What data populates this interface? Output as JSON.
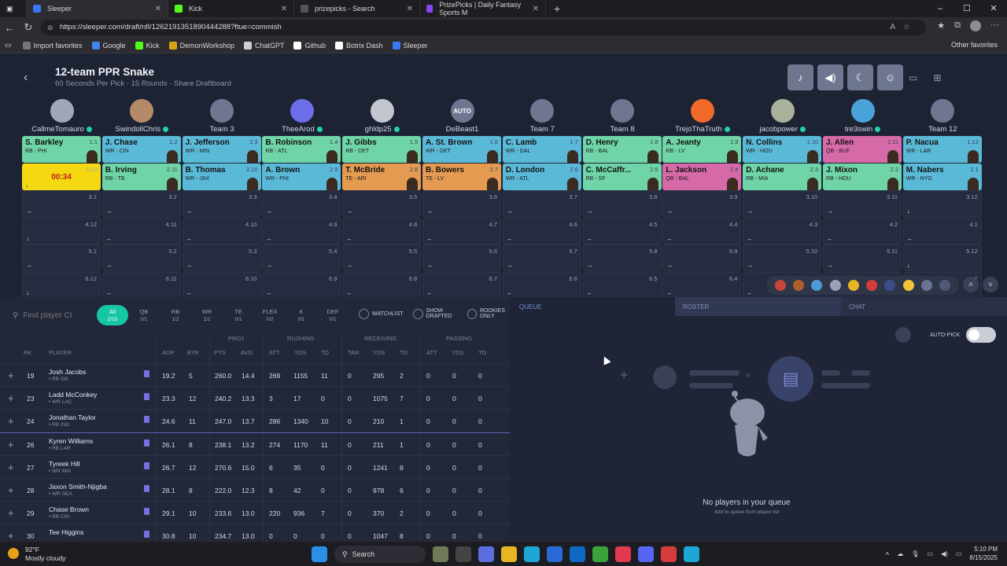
{
  "browser": {
    "tabs": [
      {
        "label": "Sleeper",
        "color": "#3a78f2",
        "active": true
      },
      {
        "label": "Kick",
        "color": "#53fc18",
        "active": false
      },
      {
        "label": "prizepicks - Search",
        "color": "#555",
        "active": false
      },
      {
        "label": "PrizePicks | Daily Fantasy Sports M",
        "color": "#8b43f2",
        "active": false
      }
    ],
    "url": "https://sleeper.com/draft/nfl/1262191351890444288?ftue=commish",
    "bookmarks": [
      {
        "label": "Import favorites",
        "color": "#777"
      },
      {
        "label": "Google",
        "color": "#4285f4"
      },
      {
        "label": "Kick",
        "color": "#53fc18"
      },
      {
        "label": "DemonWorkshop",
        "color": "#d9a318"
      },
      {
        "label": "ChatGPT",
        "color": "#cfcfcf"
      },
      {
        "label": "Github",
        "color": "#ffffff"
      },
      {
        "label": "Botrix Dash",
        "color": "#ffffff"
      },
      {
        "label": "Sleeper",
        "color": "#3a78f2"
      }
    ],
    "other_favorites": "Other favorites"
  },
  "draft": {
    "title": "12-team PPR Snake",
    "subtitle": "60 Seconds Per Pick · 15 Rounds · Share Draftboard"
  },
  "teams": [
    {
      "name": "CallmeTomauro",
      "online": true,
      "color": "#9fa7b9"
    },
    {
      "name": "SwindollChris",
      "online": true,
      "color": "#b48a6a"
    },
    {
      "name": "Team 3",
      "online": false,
      "color": "#6e7690"
    },
    {
      "name": "TheeArod",
      "online": true,
      "color": "#6b6ee8"
    },
    {
      "name": "ghldp25",
      "online": true,
      "color": "#c2c6cf"
    },
    {
      "name": "DeBeast1",
      "online": false,
      "color": "#6e7690",
      "badge": "AUTO"
    },
    {
      "name": "Team 7",
      "online": false,
      "color": "#6e7690"
    },
    {
      "name": "Team 8",
      "online": false,
      "color": "#6e7690"
    },
    {
      "name": "TrejoThaTruth",
      "online": true,
      "color": "#f06a2a"
    },
    {
      "name": "jacobpower",
      "online": true,
      "color": "#a9b29a"
    },
    {
      "name": "tre3swin",
      "online": true,
      "color": "#4aa3d8"
    },
    {
      "name": "Team 12",
      "online": false,
      "color": "#6e7690"
    }
  ],
  "round1": [
    {
      "name": "S. Barkley",
      "pos": "RB - PHI",
      "pick": "1.1",
      "color": "#6fd4a8"
    },
    {
      "name": "J. Chase",
      "pos": "WR - CIN",
      "pick": "1.2",
      "color": "#5bb9d8"
    },
    {
      "name": "J. Jefferson",
      "pos": "WR - MIN",
      "pick": "1.3",
      "color": "#5bb9d8"
    },
    {
      "name": "B. Robinson",
      "pos": "RB - ATL",
      "pick": "1.4",
      "color": "#6fd4a8"
    },
    {
      "name": "J. Gibbs",
      "pos": "RB - DET",
      "pick": "1.5",
      "color": "#6fd4a8"
    },
    {
      "name": "A. St. Brown",
      "pos": "WR - DET",
      "pick": "1.6",
      "color": "#5bb9d8"
    },
    {
      "name": "C. Lamb",
      "pos": "WR - DAL",
      "pick": "1.7",
      "color": "#5bb9d8"
    },
    {
      "name": "D. Henry",
      "pos": "RB - BAL",
      "pick": "1.8",
      "color": "#6fd4a8"
    },
    {
      "name": "A. Jeanty",
      "pos": "RB - LV",
      "pick": "1.9",
      "color": "#6fd4a8"
    },
    {
      "name": "N. Collins",
      "pos": "WR - HOU",
      "pick": "1.10",
      "color": "#5bb9d8"
    },
    {
      "name": "J. Allen",
      "pos": "QB - BUF",
      "pick": "1.11",
      "color": "#d66aa8"
    },
    {
      "name": "P. Nacua",
      "pos": "WR - LAR",
      "pick": "1.12",
      "color": "#5bb9d8"
    }
  ],
  "round2": [
    {
      "timer": "00:34",
      "pick": "2.12"
    },
    {
      "name": "B. Irving",
      "pos": "RB - TB",
      "pick": "2.11",
      "color": "#6fd4a8"
    },
    {
      "name": "B. Thomas",
      "pos": "WR - JAX",
      "pick": "2.10",
      "color": "#5bb9d8"
    },
    {
      "name": "A. Brown",
      "pos": "WR - PHI",
      "pick": "2.9",
      "color": "#5bb9d8"
    },
    {
      "name": "T. McBride",
      "pos": "TE - ARI",
      "pick": "2.8",
      "color": "#e59a52"
    },
    {
      "name": "B. Bowers",
      "pos": "TE - LV",
      "pick": "2.7",
      "color": "#e59a52"
    },
    {
      "name": "D. London",
      "pos": "WR - ATL",
      "pick": "2.6",
      "color": "#5bb9d8"
    },
    {
      "name": "C. McCaffr...",
      "pos": "RB - SF",
      "pick": "2.5",
      "color": "#6fd4a8"
    },
    {
      "name": "L. Jackson",
      "pos": "QB - BAL",
      "pick": "2.4",
      "color": "#d66aa8"
    },
    {
      "name": "D. Achane",
      "pos": "RB - MIA",
      "pick": "2.3",
      "color": "#6fd4a8"
    },
    {
      "name": "J. Mixon",
      "pos": "RB - HOU",
      "pick": "2.2",
      "color": "#6fd4a8"
    },
    {
      "name": "M. Nabers",
      "pos": "WR - NYG",
      "pick": "2.1",
      "color": "#5bb9d8"
    }
  ],
  "empty_rounds": [
    [
      "3.1",
      "3.2",
      "3.3",
      "3.4",
      "3.5",
      "3.6",
      "3.7",
      "3.8",
      "3.9",
      "3.10",
      "3.11",
      "3.12"
    ],
    [
      "4.12",
      "4.11",
      "4.10",
      "4.9",
      "4.8",
      "4.7",
      "4.6",
      "4.5",
      "4.4",
      "4.3",
      "4.2",
      "4.1"
    ],
    [
      "5.1",
      "5.2",
      "5.3",
      "5.4",
      "5.5",
      "5.6",
      "5.7",
      "5.8",
      "5.9",
      "5.10",
      "5.11",
      "5.12"
    ],
    [
      "6.12",
      "6.11",
      "6.10",
      "6.9",
      "6.8",
      "6.7",
      "6.6",
      "6.5",
      "6.4",
      "6.3",
      "6.2",
      "6.1"
    ]
  ],
  "player_panel": {
    "search_placeholder": "Find player Ct",
    "positions": [
      {
        "label": "All",
        "count": "2/15",
        "active": true
      },
      {
        "label": "QB",
        "count": "0/1"
      },
      {
        "label": "RB",
        "count": "1/2"
      },
      {
        "label": "WR",
        "count": "1/2"
      },
      {
        "label": "TE",
        "count": "0/1"
      },
      {
        "label": "FLEX",
        "count": "0/2"
      },
      {
        "label": "K",
        "count": "0/1"
      },
      {
        "label": "DEF",
        "count": "0/1"
      }
    ],
    "filters": [
      "WATCHLIST",
      "SHOW DRAFTED",
      "ROOKIES ONLY"
    ],
    "groups": {
      "proj": "PROJ",
      "rushing": "RUSHING",
      "receiving": "RECEIVING",
      "passing": "PASSING"
    },
    "columns": [
      "RK",
      "PLAYER",
      "ADP",
      "BYE",
      "PTS",
      "AVG",
      "ATT",
      "YDS",
      "TD",
      "TAR",
      "YDS",
      "TD",
      "ATT",
      "YDS",
      "TD"
    ],
    "rows": [
      {
        "rk": "19",
        "name": "Josh Jacobs",
        "meta": "• RB  GB",
        "adp": "19.2",
        "bye": "5",
        "pts": "260.0",
        "avg": "14.4",
        "ratt": "269",
        "ryds": "1155",
        "rtd": "11",
        "tar": "0",
        "recyds": "295",
        "rectd": "2",
        "patt": "0",
        "pyds": "0",
        "ptd": "0"
      },
      {
        "rk": "23",
        "name": "Ladd McConkey",
        "meta": "• WR  LAC",
        "adp": "23.3",
        "bye": "12",
        "pts": "240.2",
        "avg": "13.3",
        "ratt": "3",
        "ryds": "17",
        "rtd": "0",
        "tar": "0",
        "recyds": "1075",
        "rectd": "7",
        "patt": "0",
        "pyds": "0",
        "ptd": "0"
      },
      {
        "rk": "24",
        "name": "Jonathan Taylor",
        "meta": "• RB  IND",
        "adp": "24.6",
        "bye": "11",
        "pts": "247.0",
        "avg": "13.7",
        "ratt": "286",
        "ryds": "1340",
        "rtd": "10",
        "tar": "0",
        "recyds": "210",
        "rectd": "1",
        "patt": "0",
        "pyds": "0",
        "ptd": "0"
      },
      {
        "rk": "26",
        "name": "Kyren Williams",
        "meta": "• RB  LAR",
        "adp": "26.1",
        "bye": "8",
        "pts": "238.1",
        "avg": "13.2",
        "ratt": "274",
        "ryds": "1170",
        "rtd": "11",
        "tar": "0",
        "recyds": "211",
        "rectd": "1",
        "patt": "0",
        "pyds": "0",
        "ptd": "0"
      },
      {
        "rk": "27",
        "name": "Tyreek Hill",
        "meta": "• WR  MIA",
        "adp": "26.7",
        "bye": "12",
        "pts": "270.6",
        "avg": "15.0",
        "ratt": "6",
        "ryds": "35",
        "rtd": "0",
        "tar": "0",
        "recyds": "1241",
        "rectd": "8",
        "patt": "0",
        "pyds": "0",
        "ptd": "0"
      },
      {
        "rk": "28",
        "name": "Jaxon Smith-Njigba",
        "meta": "• WR  SEA",
        "adp": "28.1",
        "bye": "8",
        "pts": "222.0",
        "avg": "12.3",
        "ratt": "8",
        "ryds": "42",
        "rtd": "0",
        "tar": "0",
        "recyds": "978",
        "rectd": "6",
        "patt": "0",
        "pyds": "0",
        "ptd": "0"
      },
      {
        "rk": "29",
        "name": "Chase Brown",
        "meta": "• RB  CIN",
        "adp": "29.1",
        "bye": "10",
        "pts": "233.6",
        "avg": "13.0",
        "ratt": "220",
        "ryds": "936",
        "rtd": "7",
        "tar": "0",
        "recyds": "370",
        "rectd": "2",
        "patt": "0",
        "pyds": "0",
        "ptd": "0"
      },
      {
        "rk": "30",
        "name": "Tee Higgins",
        "meta": "",
        "adp": "30.8",
        "bye": "10",
        "pts": "234.7",
        "avg": "13.0",
        "ratt": "0",
        "ryds": "0",
        "rtd": "0",
        "tar": "0",
        "recyds": "1047",
        "rectd": "8",
        "patt": "0",
        "pyds": "0",
        "ptd": "0"
      }
    ]
  },
  "queue": {
    "label": "QUEUE",
    "empty_title": "No players in your queue",
    "empty_sub": "Add to queue from player list"
  },
  "right_tabs": [
    "ROSTER",
    "CHAT"
  ],
  "autopick": {
    "label": "AUTO-PICK"
  },
  "taskbar": {
    "temp": "92°F",
    "condition": "Mostly cloudy",
    "search": "Search",
    "time": "5:10 PM",
    "date": "8/15/2025"
  }
}
